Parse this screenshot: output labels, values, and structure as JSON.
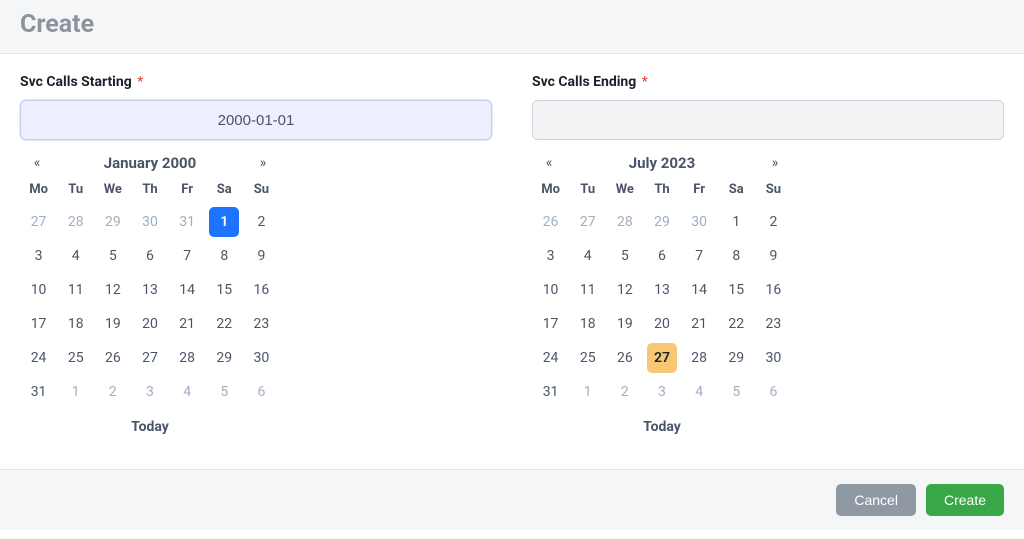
{
  "page": {
    "title": "Create"
  },
  "fields": {
    "start": {
      "label": "Svc Calls Starting",
      "value": "2000-01-01",
      "placeholder": ""
    },
    "end": {
      "label": "Svc Calls Ending",
      "value": "",
      "placeholder": ""
    }
  },
  "dow": [
    "Mo",
    "Tu",
    "We",
    "Th",
    "Fr",
    "Sa",
    "Su"
  ],
  "calendars": {
    "start": {
      "title": "January 2000",
      "prev": "«",
      "next": "»",
      "today_label": "Today",
      "days": [
        {
          "n": 27,
          "out": true
        },
        {
          "n": 28,
          "out": true
        },
        {
          "n": 29,
          "out": true
        },
        {
          "n": 30,
          "out": true
        },
        {
          "n": 31,
          "out": true
        },
        {
          "n": 1,
          "selected": true
        },
        {
          "n": 2
        },
        {
          "n": 3
        },
        {
          "n": 4
        },
        {
          "n": 5
        },
        {
          "n": 6
        },
        {
          "n": 7
        },
        {
          "n": 8
        },
        {
          "n": 9
        },
        {
          "n": 10
        },
        {
          "n": 11
        },
        {
          "n": 12
        },
        {
          "n": 13
        },
        {
          "n": 14
        },
        {
          "n": 15
        },
        {
          "n": 16
        },
        {
          "n": 17
        },
        {
          "n": 18
        },
        {
          "n": 19
        },
        {
          "n": 20
        },
        {
          "n": 21
        },
        {
          "n": 22
        },
        {
          "n": 23
        },
        {
          "n": 24
        },
        {
          "n": 25
        },
        {
          "n": 26
        },
        {
          "n": 27
        },
        {
          "n": 28
        },
        {
          "n": 29
        },
        {
          "n": 30
        },
        {
          "n": 31
        },
        {
          "n": 1,
          "out": true
        },
        {
          "n": 2,
          "out": true
        },
        {
          "n": 3,
          "out": true
        },
        {
          "n": 4,
          "out": true
        },
        {
          "n": 5,
          "out": true
        },
        {
          "n": 6,
          "out": true
        }
      ]
    },
    "end": {
      "title": "July 2023",
      "prev": "«",
      "next": "»",
      "today_label": "Today",
      "days": [
        {
          "n": 26,
          "out": true
        },
        {
          "n": 27,
          "out": true
        },
        {
          "n": 28,
          "out": true
        },
        {
          "n": 29,
          "out": true
        },
        {
          "n": 30,
          "out": true
        },
        {
          "n": 1
        },
        {
          "n": 2
        },
        {
          "n": 3
        },
        {
          "n": 4
        },
        {
          "n": 5
        },
        {
          "n": 6
        },
        {
          "n": 7
        },
        {
          "n": 8
        },
        {
          "n": 9
        },
        {
          "n": 10
        },
        {
          "n": 11
        },
        {
          "n": 12
        },
        {
          "n": 13
        },
        {
          "n": 14
        },
        {
          "n": 15
        },
        {
          "n": 16
        },
        {
          "n": 17
        },
        {
          "n": 18
        },
        {
          "n": 19
        },
        {
          "n": 20
        },
        {
          "n": 21
        },
        {
          "n": 22
        },
        {
          "n": 23
        },
        {
          "n": 24
        },
        {
          "n": 25
        },
        {
          "n": 26
        },
        {
          "n": 27,
          "today": true
        },
        {
          "n": 28
        },
        {
          "n": 29
        },
        {
          "n": 30
        },
        {
          "n": 31
        },
        {
          "n": 1,
          "out": true
        },
        {
          "n": 2,
          "out": true
        },
        {
          "n": 3,
          "out": true
        },
        {
          "n": 4,
          "out": true
        },
        {
          "n": 5,
          "out": true
        },
        {
          "n": 6,
          "out": true
        }
      ]
    }
  },
  "buttons": {
    "cancel": "Cancel",
    "create": "Create"
  },
  "required_mark": "*"
}
